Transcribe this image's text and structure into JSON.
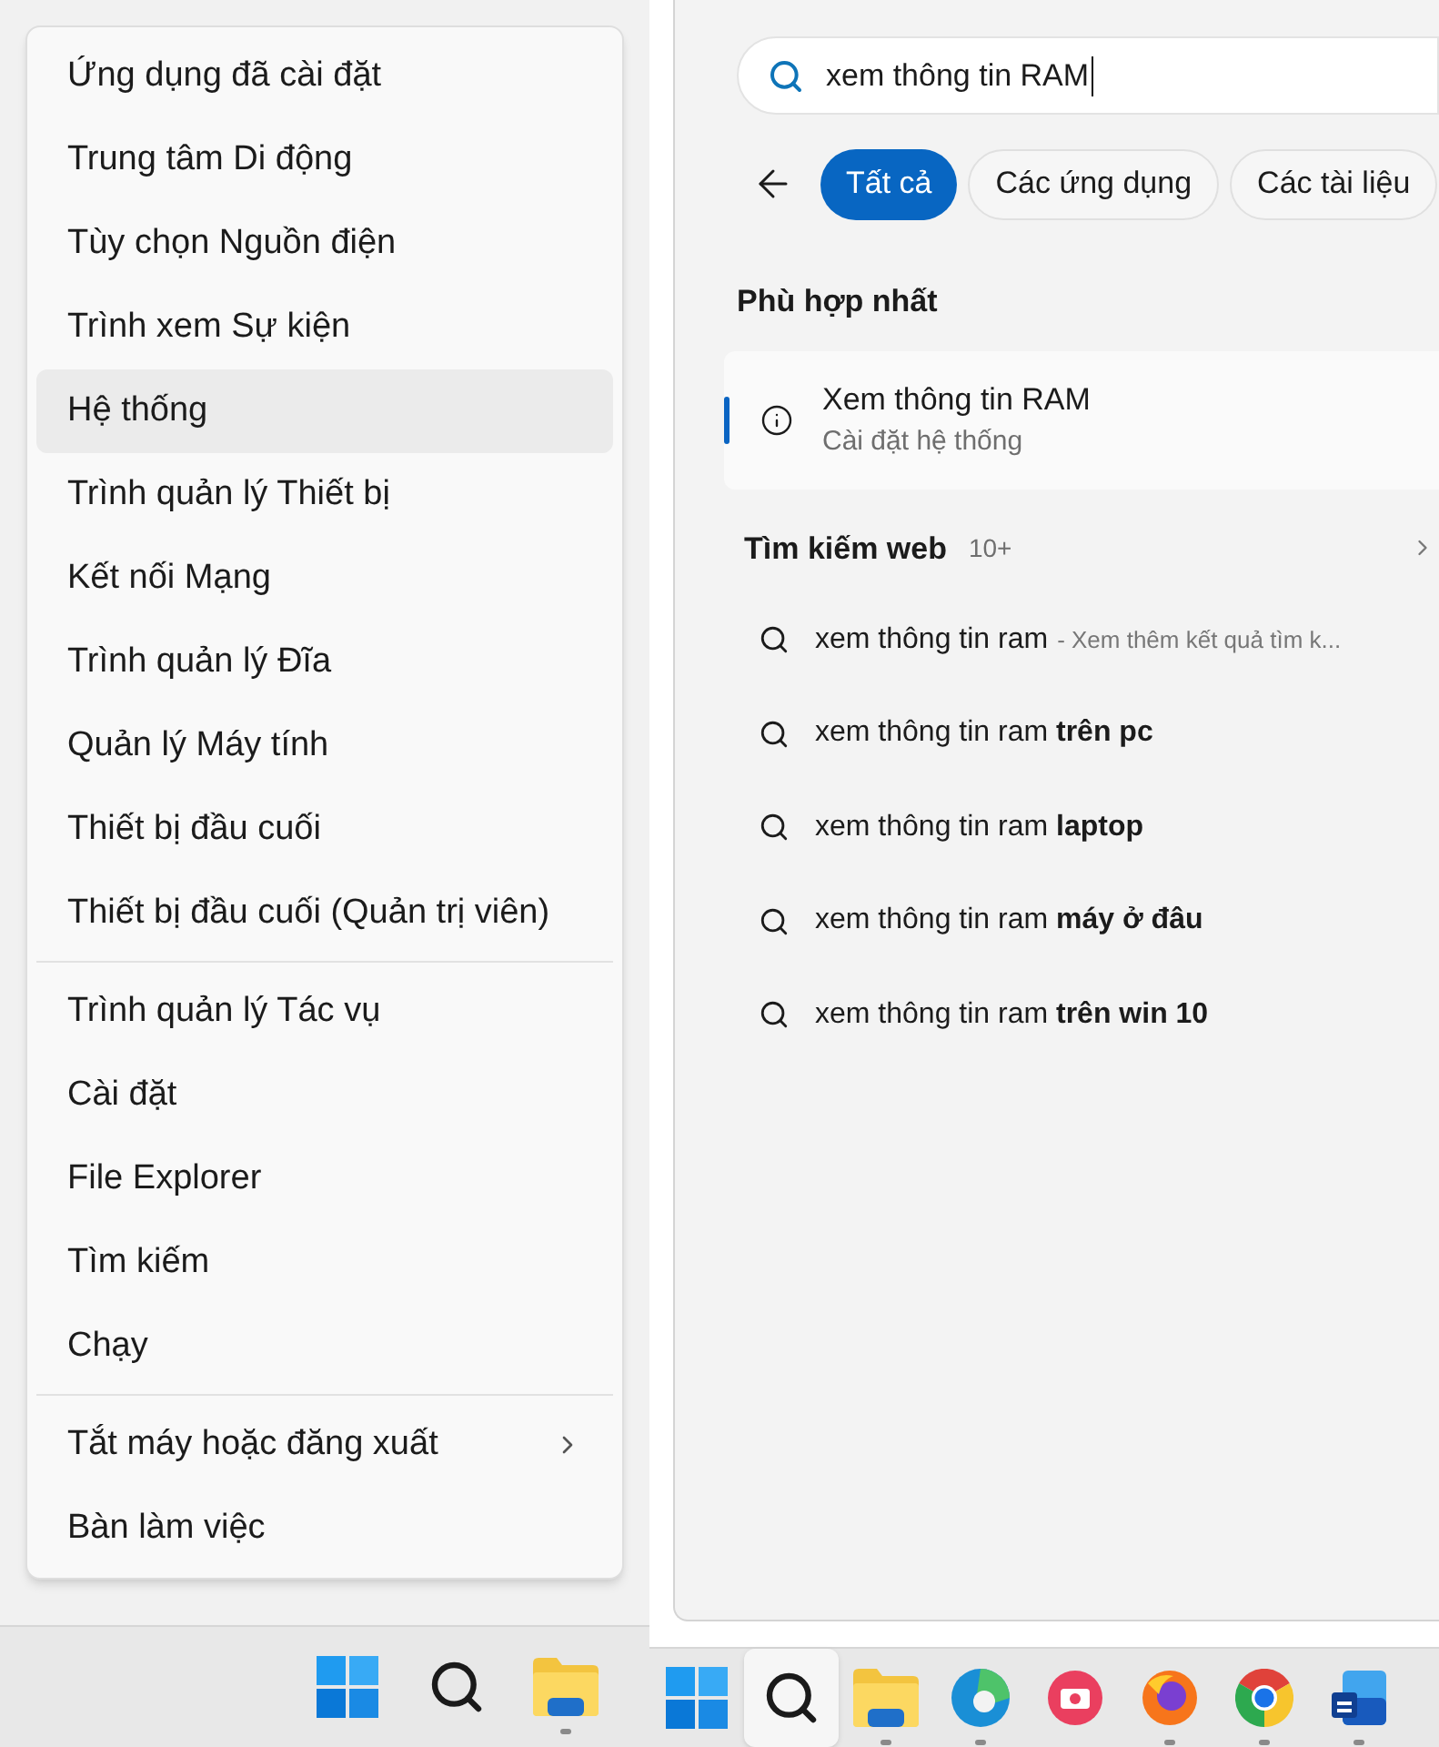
{
  "context_menu": {
    "groups": [
      [
        {
          "label": "Ứng dụng đã cài đặt",
          "highlighted": false,
          "submenu": false
        },
        {
          "label": "Trung tâm Di động",
          "highlighted": false,
          "submenu": false
        },
        {
          "label": "Tùy chọn Nguồn điện",
          "highlighted": false,
          "submenu": false
        },
        {
          "label": "Trình xem Sự kiện",
          "highlighted": false,
          "submenu": false
        },
        {
          "label": "Hệ thống",
          "highlighted": true,
          "submenu": false
        },
        {
          "label": "Trình quản lý Thiết bị",
          "highlighted": false,
          "submenu": false
        },
        {
          "label": "Kết nối Mạng",
          "highlighted": false,
          "submenu": false
        },
        {
          "label": "Trình quản lý Đĩa",
          "highlighted": false,
          "submenu": false
        },
        {
          "label": "Quản lý Máy tính",
          "highlighted": false,
          "submenu": false
        },
        {
          "label": "Thiết bị đầu cuối",
          "highlighted": false,
          "submenu": false
        },
        {
          "label": "Thiết bị đầu cuối (Quản trị viên)",
          "highlighted": false,
          "submenu": false
        }
      ],
      [
        {
          "label": "Trình quản lý Tác vụ",
          "highlighted": false,
          "submenu": false
        },
        {
          "label": "Cài đặt",
          "highlighted": false,
          "submenu": false
        },
        {
          "label": "File Explorer",
          "highlighted": false,
          "submenu": false
        },
        {
          "label": "Tìm kiếm",
          "highlighted": false,
          "submenu": false
        },
        {
          "label": "Chạy",
          "highlighted": false,
          "submenu": false
        }
      ],
      [
        {
          "label": "Tắt máy hoặc đăng xuất",
          "highlighted": false,
          "submenu": true
        },
        {
          "label": "Bàn làm việc",
          "highlighted": false,
          "submenu": false
        }
      ]
    ]
  },
  "left_taskbar": [
    {
      "kind": "start",
      "selected": false,
      "running": false
    },
    {
      "kind": "search",
      "selected": false,
      "running": false
    },
    {
      "kind": "explorer",
      "selected": false,
      "running": true
    }
  ],
  "search_panel": {
    "search_field": {
      "value": "xem thông tin RAM"
    },
    "filters": [
      {
        "label": "Tất cả",
        "selected": true
      },
      {
        "label": "Các ứng dụng",
        "selected": false
      },
      {
        "label": "Các tài liệu",
        "selected": false
      }
    ],
    "best_match": {
      "heading": "Phù hợp nhất",
      "title": "Xem thông tin RAM",
      "subtitle": "Cài đặt hệ thống",
      "selected": true
    },
    "web_search": {
      "heading": "Tìm kiếm web",
      "count": "10+",
      "suggestions": [
        {
          "text": "xem thông tin ram",
          "hint": "- Xem thêm kết quả tìm k..."
        },
        {
          "text": "xem thông tin ram **trên pc**"
        },
        {
          "text": "xem thông tin ram **laptop**"
        },
        {
          "text": "xem thông tin ram **máy ở đâu**"
        },
        {
          "text": "xem thông tin ram **trên win 10**"
        }
      ]
    }
  },
  "right_taskbar": [
    {
      "kind": "start",
      "selected": false,
      "running": false
    },
    {
      "kind": "search",
      "selected": true,
      "running": false
    },
    {
      "kind": "explorer",
      "selected": false,
      "running": true
    },
    {
      "kind": "edge",
      "selected": false,
      "running": true
    },
    {
      "kind": "camera",
      "selected": false,
      "running": false
    },
    {
      "kind": "firefox",
      "selected": false,
      "running": true
    },
    {
      "kind": "chrome",
      "selected": false,
      "running": true
    },
    {
      "kind": "word",
      "selected": false,
      "running": true
    }
  ]
}
